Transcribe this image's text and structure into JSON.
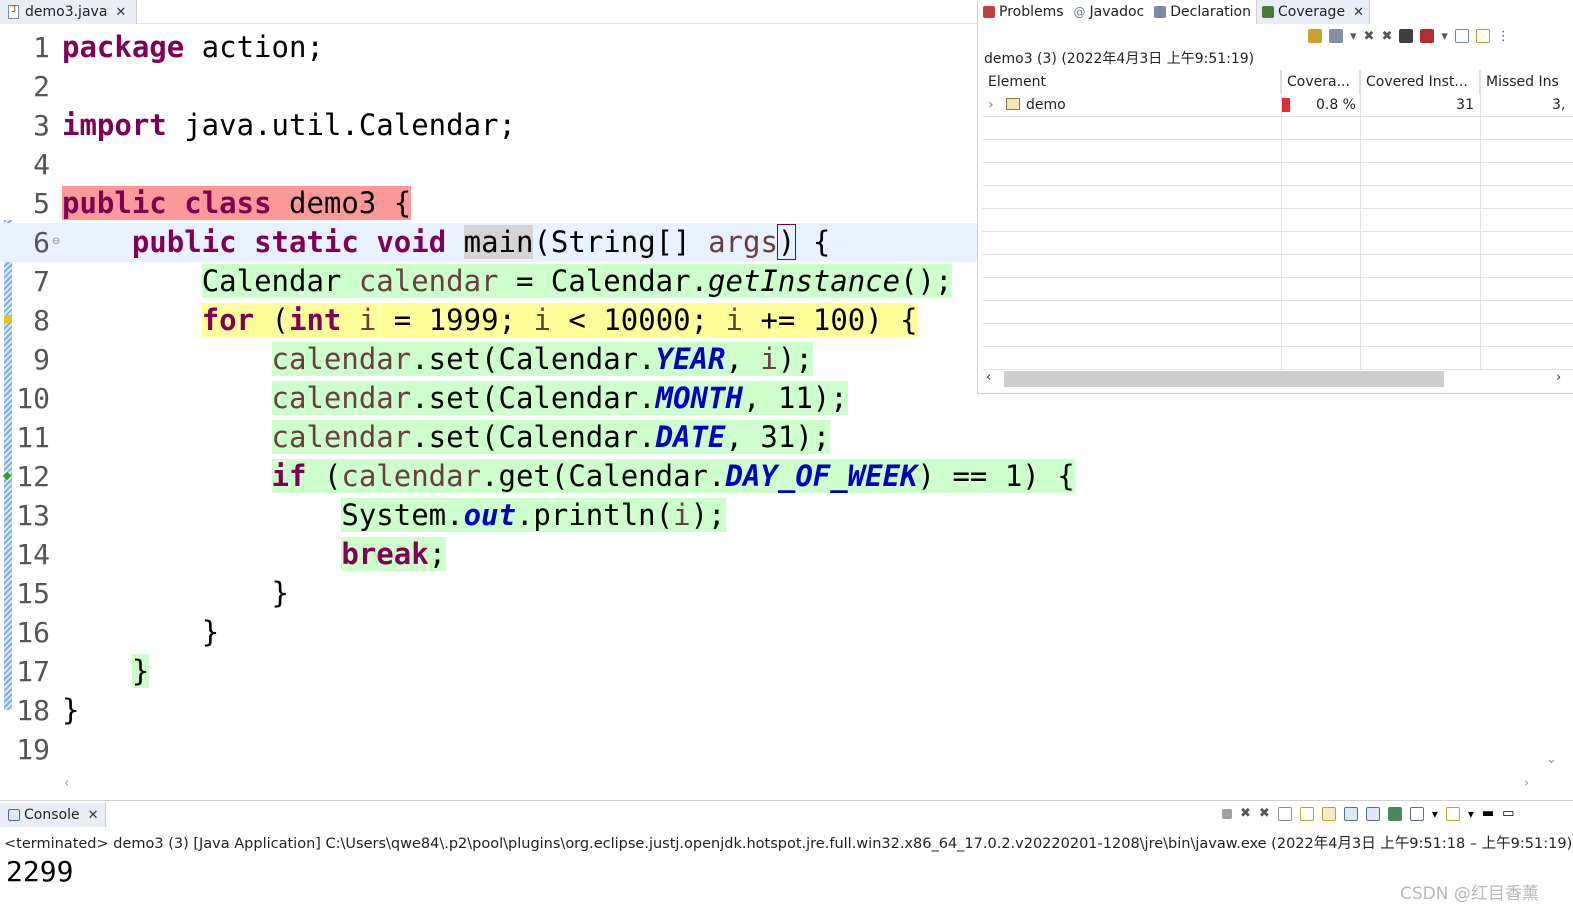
{
  "editor": {
    "tab_label": "demo3.java",
    "close_symbol": "✕",
    "lines": [
      {
        "n": "1",
        "tokens": [
          {
            "t": "package",
            "c": "kw"
          },
          {
            "t": " action;",
            "c": ""
          }
        ]
      },
      {
        "n": "2",
        "tokens": []
      },
      {
        "n": "3",
        "tokens": [
          {
            "t": "import",
            "c": "kw"
          },
          {
            "t": " java.util.Calendar;",
            "c": ""
          }
        ]
      },
      {
        "n": "4",
        "tokens": []
      },
      {
        "n": "5",
        "hl": "hl-red",
        "tokens": [
          {
            "t": "public",
            "c": "kw"
          },
          {
            "t": " ",
            "c": ""
          },
          {
            "t": "class",
            "c": "kw"
          },
          {
            "t": " demo3 {",
            "c": ""
          }
        ]
      },
      {
        "n": "6",
        "fold": true,
        "hl": "",
        "tokens": [
          {
            "t": "    ",
            "c": ""
          },
          {
            "t": "public",
            "c": "kw"
          },
          {
            "t": " ",
            "c": ""
          },
          {
            "t": "static",
            "c": "kw"
          },
          {
            "t": " ",
            "c": ""
          },
          {
            "t": "void",
            "c": "kw"
          },
          {
            "t": " ",
            "c": ""
          },
          {
            "t": "main",
            "c": "main-box"
          },
          {
            "t": "(String[] ",
            "c": ""
          },
          {
            "t": "args",
            "c": "var"
          },
          {
            "t": ")",
            "c": "paren-box"
          },
          {
            "t": " {",
            "c": ""
          }
        ]
      },
      {
        "n": "7",
        "hl": "hl-green",
        "tokens": [
          {
            "t": "        Calendar ",
            "c": ""
          },
          {
            "t": "calendar",
            "c": "var"
          },
          {
            "t": " = Calendar.",
            "c": ""
          },
          {
            "t": "getInstance",
            "c": "mth"
          },
          {
            "t": "();",
            "c": ""
          }
        ]
      },
      {
        "n": "8",
        "hl": "hl-yellow",
        "marker": "warn",
        "tokens": [
          {
            "t": "        ",
            "c": ""
          },
          {
            "t": "for",
            "c": "kw"
          },
          {
            "t": " (",
            "c": ""
          },
          {
            "t": "int",
            "c": "kw"
          },
          {
            "t": " ",
            "c": ""
          },
          {
            "t": "i",
            "c": "var"
          },
          {
            "t": " = 1999; ",
            "c": ""
          },
          {
            "t": "i",
            "c": "var"
          },
          {
            "t": " < 10000; ",
            "c": ""
          },
          {
            "t": "i",
            "c": "var"
          },
          {
            "t": " += 100) {",
            "c": ""
          }
        ]
      },
      {
        "n": "9",
        "hl": "hl-green",
        "tokens": [
          {
            "t": "            ",
            "c": ""
          },
          {
            "t": "calendar",
            "c": "var"
          },
          {
            "t": ".set(Calendar.",
            "c": ""
          },
          {
            "t": "YEAR",
            "c": "fld"
          },
          {
            "t": ", ",
            "c": ""
          },
          {
            "t": "i",
            "c": "var"
          },
          {
            "t": ");",
            "c": ""
          }
        ]
      },
      {
        "n": "10",
        "hl": "hl-green",
        "tokens": [
          {
            "t": "            ",
            "c": ""
          },
          {
            "t": "calendar",
            "c": "var"
          },
          {
            "t": ".set(Calendar.",
            "c": ""
          },
          {
            "t": "MONTH",
            "c": "fld"
          },
          {
            "t": ", 11);",
            "c": ""
          }
        ]
      },
      {
        "n": "11",
        "hl": "hl-green",
        "tokens": [
          {
            "t": "            ",
            "c": ""
          },
          {
            "t": "calendar",
            "c": "var"
          },
          {
            "t": ".set(Calendar.",
            "c": ""
          },
          {
            "t": "DATE",
            "c": "fld"
          },
          {
            "t": ", 31);",
            "c": ""
          }
        ]
      },
      {
        "n": "12",
        "hl": "hl-green",
        "marker": "bp",
        "tokens": [
          {
            "t": "            ",
            "c": ""
          },
          {
            "t": "if",
            "c": "kw"
          },
          {
            "t": " (",
            "c": ""
          },
          {
            "t": "calendar",
            "c": "var"
          },
          {
            "t": ".get(Calendar.",
            "c": ""
          },
          {
            "t": "DAY_OF_WEEK",
            "c": "fld"
          },
          {
            "t": ") == 1) {",
            "c": ""
          }
        ]
      },
      {
        "n": "13",
        "hl": "hl-green",
        "tokens": [
          {
            "t": "                System.",
            "c": ""
          },
          {
            "t": "out",
            "c": "fld"
          },
          {
            "t": ".println(",
            "c": ""
          },
          {
            "t": "i",
            "c": "var"
          },
          {
            "t": ");",
            "c": ""
          }
        ]
      },
      {
        "n": "14",
        "hl": "hl-green",
        "tokens": [
          {
            "t": "                ",
            "c": ""
          },
          {
            "t": "break",
            "c": "kw"
          },
          {
            "t": ";",
            "c": ""
          }
        ]
      },
      {
        "n": "15",
        "tokens": [
          {
            "t": "            }",
            "c": ""
          }
        ]
      },
      {
        "n": "16",
        "tokens": [
          {
            "t": "        }",
            "c": ""
          }
        ]
      },
      {
        "n": "17",
        "hl": "hl-green",
        "tokens": [
          {
            "t": "    }",
            "c": ""
          }
        ]
      },
      {
        "n": "18",
        "tokens": [
          {
            "t": "}",
            "c": ""
          }
        ]
      },
      {
        "n": "19",
        "tokens": []
      }
    ]
  },
  "coverage_panel": {
    "tabs": [
      {
        "label": "Problems",
        "icon": "problems-icon",
        "color": "#c04040"
      },
      {
        "label": "Javadoc",
        "icon": "javadoc-icon",
        "color": "#6a7fa8"
      },
      {
        "label": "Declaration",
        "icon": "declaration-icon",
        "color": "#7a8aa0"
      },
      {
        "label": "Coverage",
        "icon": "coverage-icon",
        "color": "#4a7a3a",
        "active": true
      }
    ],
    "session_label": "demo3 (3) (2022年4月3日 上午9:51:19)",
    "columns": [
      "Element",
      "Covera...",
      "Covered Inst...",
      "Missed Ins"
    ],
    "rows": [
      {
        "expander": "›",
        "element": "demo",
        "coverage": "0.8 %",
        "covered": "31",
        "missed": "3,"
      }
    ]
  },
  "console": {
    "tab_label": "Console",
    "status": "<terminated> demo3 (3) [Java Application] C:\\Users\\qwe84\\.p2\\pool\\plugins\\org.eclipse.justj.openjdk.hotspot.jre.full.win32.x86_64_17.0.2.v20220201-1208\\jre\\bin\\javaw.exe  (2022年4月3日 上午9:51:18 – 上午9:51:19)",
    "output": "2299"
  },
  "watermark": "CSDN @红目香薰",
  "colors": {
    "keyword": "#7f0055",
    "covered": "#ccffcc",
    "partial": "#ffff99",
    "missed": "#ff9999"
  }
}
